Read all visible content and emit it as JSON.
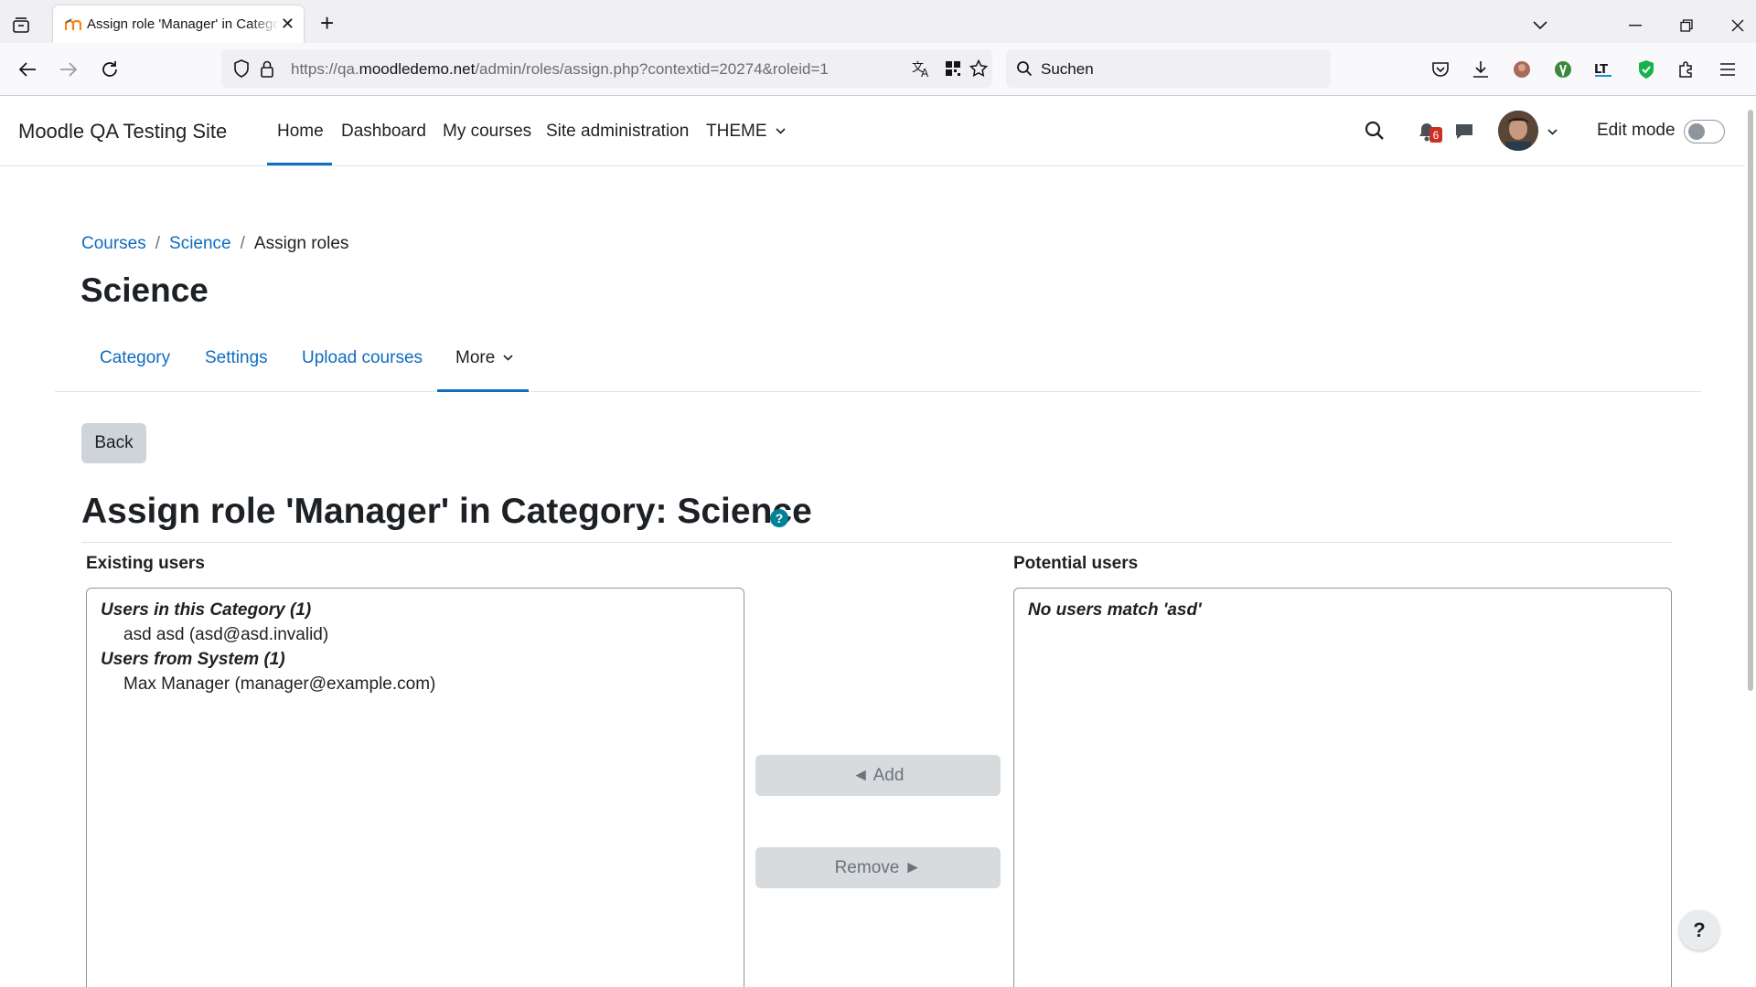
{
  "browser": {
    "tab_title": "Assign role 'Manager' in Category: Science",
    "url_prefix": "https://qa.",
    "url_domain": "moodledemo.net",
    "url_path": "/admin/roles/assign.php?contextid=20274&roleid=1",
    "search_placeholder": "Suchen"
  },
  "site": {
    "name": "Moodle QA Testing Site",
    "nav": [
      "Home",
      "Dashboard",
      "My courses",
      "Site administration",
      "THEME"
    ],
    "notification_count": "6",
    "edit_mode_label": "Edit mode"
  },
  "breadcrumb": [
    "Courses",
    "Science",
    "Assign roles"
  ],
  "page_title": "Science",
  "secondary_nav": [
    "Category",
    "Settings",
    "Upload courses",
    "More"
  ],
  "back_label": "Back",
  "heading": "Assign role 'Manager' in Category: Science",
  "existing": {
    "label": "Existing users",
    "groups": [
      {
        "label": "Users in this Category (1)",
        "options": [
          "asd asd (asd@asd.invalid)"
        ]
      },
      {
        "label": "Users from System (1)",
        "options": [
          "Max Manager (manager@example.com)"
        ]
      }
    ]
  },
  "potential": {
    "label": "Potential users",
    "no_match": "No users match 'asd'"
  },
  "buttons": {
    "add": "◄ Add",
    "remove": "Remove ►"
  },
  "help_fab": "?",
  "colors": {
    "link": "#0f6cbf",
    "help": "#008196",
    "badge": "#ca3120"
  }
}
